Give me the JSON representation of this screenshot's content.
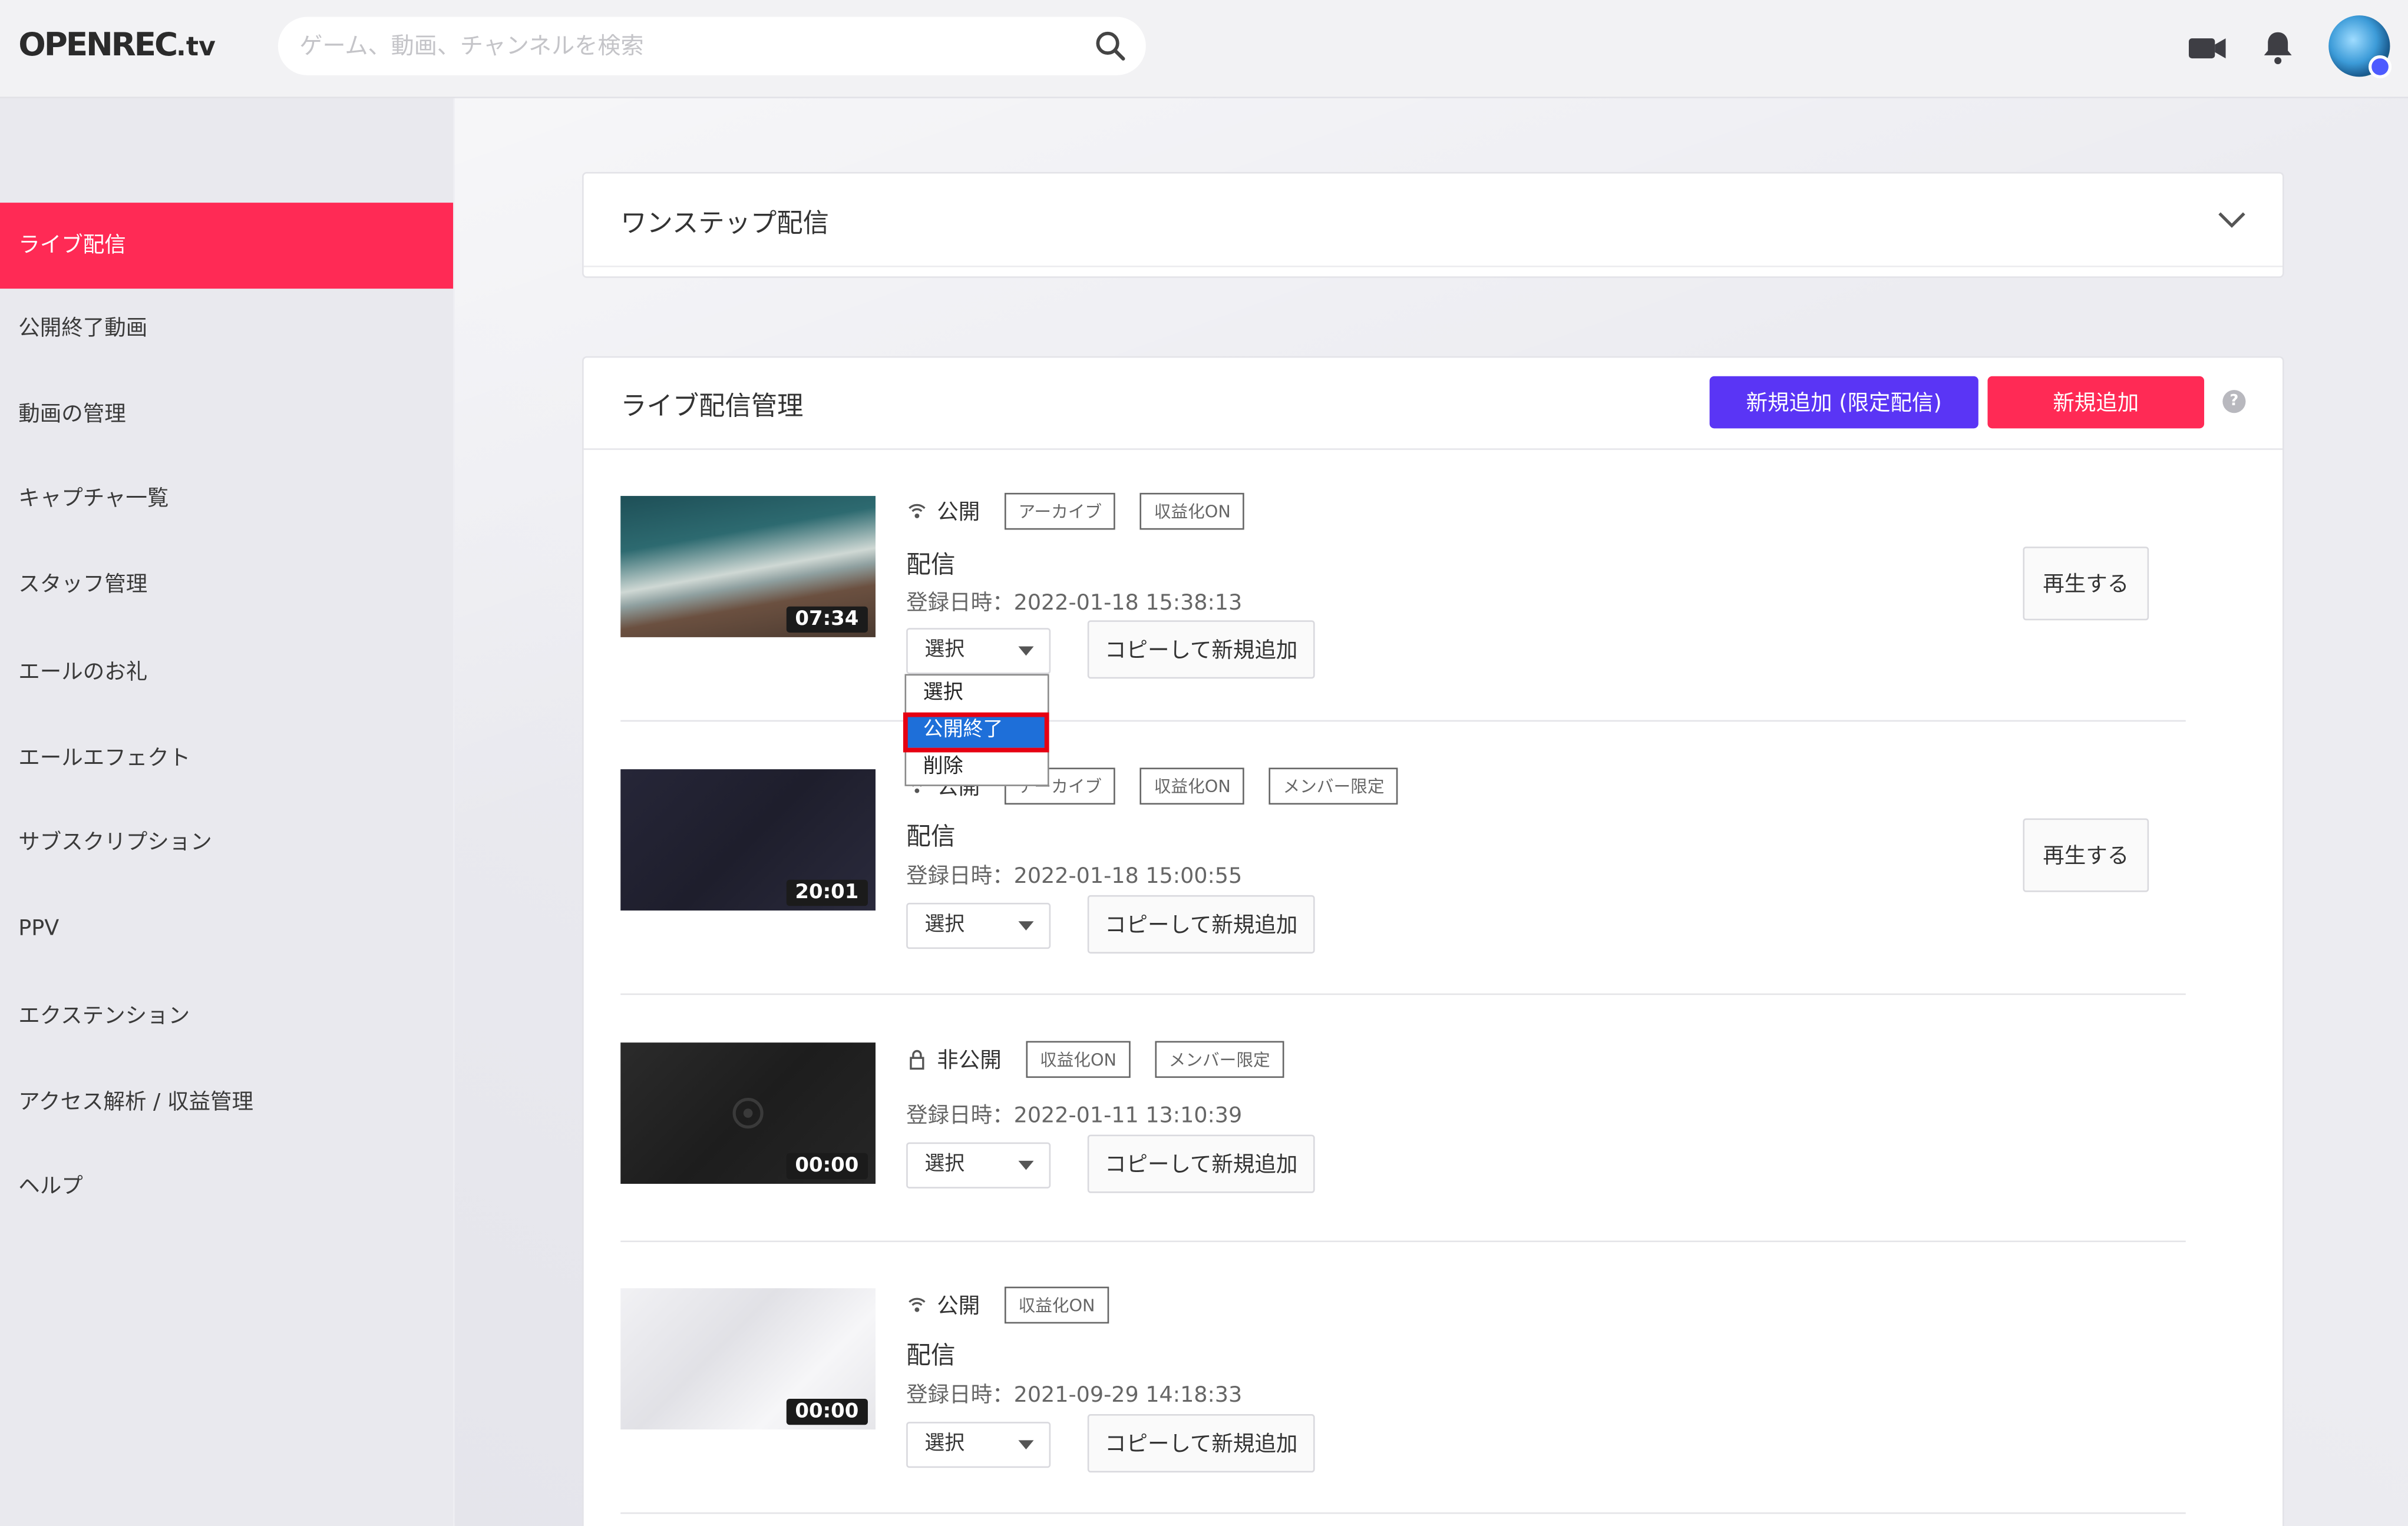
{
  "header": {
    "logo": "OPENREC",
    "logo_tv": ".tv",
    "search_placeholder": "ゲーム、動画、チャンネルを検索"
  },
  "icons": {
    "search": "search-icon",
    "camera": "video-camera-icon",
    "bell": "bell-icon",
    "chevron": "chevron-down-icon",
    "broadcast": "broadcast-icon",
    "lock": "lock-icon"
  },
  "colors": {
    "accent": "#ff2a55",
    "limited_button": "#5a35f5",
    "highlight": "#1e6fd9",
    "annotation": "#e60012"
  },
  "sidebar": {
    "items": [
      {
        "label": "ライブ配信",
        "active": true
      },
      {
        "label": "公開終了動画"
      },
      {
        "label": "動画の管理"
      },
      {
        "label": "キャプチャ一覧"
      },
      {
        "label": "スタッフ管理"
      },
      {
        "label": "エールのお礼"
      },
      {
        "label": "エールエフェクト"
      },
      {
        "label": "サブスクリプション"
      },
      {
        "label": "PPV"
      },
      {
        "label": "エクステンション"
      },
      {
        "label": "アクセス解析 / 収益管理"
      },
      {
        "label": "ヘルプ"
      }
    ]
  },
  "one_step": {
    "title": "ワンステップ配信"
  },
  "live_manage": {
    "title": "ライブ配信管理",
    "add_limited_label": "新規追加 (限定配信)",
    "add_label": "新規追加",
    "help": "?"
  },
  "rows": [
    {
      "duration": "07:34",
      "status": "公開",
      "tags": [
        "アーカイブ",
        "収益化ON"
      ],
      "name": "配信",
      "date": "登録日時：2022-01-18 15:38:13",
      "select": "選択",
      "copy_label": "コピーして新規追加",
      "play_label": "再生する"
    },
    {
      "duration": "20:01",
      "status": "公開",
      "tags": [
        "アーカイブ",
        "収益化ON",
        "メンバー限定"
      ],
      "name": "配信",
      "date": "登録日時：2022-01-18 15:00:55",
      "select": "選択",
      "copy_label": "コピーして新規追加",
      "play_label": "再生する"
    },
    {
      "duration": "00:00",
      "status": "非公開",
      "tags": [
        "収益化ON",
        "メンバー限定"
      ],
      "name": "",
      "date": "登録日時：2022-01-11 13:10:39",
      "select": "選択",
      "copy_label": "コピーして新規追加"
    },
    {
      "duration": "00:00",
      "status": "公開",
      "tags": [
        "収益化ON"
      ],
      "name": "配信",
      "date": "登録日時：2021-09-29 14:18:33",
      "select": "選択",
      "copy_label": "コピーして新規追加"
    }
  ],
  "dropdown": {
    "options": [
      "選択",
      "公開終了",
      "削除"
    ],
    "highlighted": "公開終了"
  }
}
